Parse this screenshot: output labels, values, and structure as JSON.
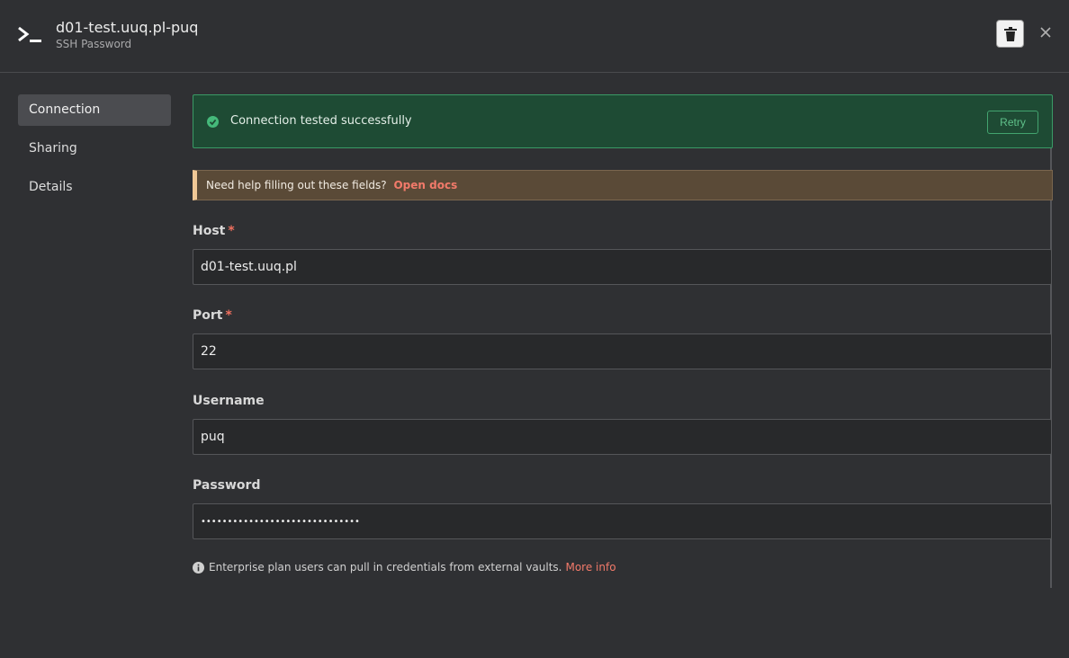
{
  "header": {
    "title": "d01-test.uuq.pl-puq",
    "subtitle": "SSH Password",
    "app_icon": "terminal-icon",
    "delete_icon": "trash-icon",
    "close_icon": "close-icon"
  },
  "sidebar": {
    "items": [
      {
        "label": "Connection",
        "active": true
      },
      {
        "label": "Sharing",
        "active": false
      },
      {
        "label": "Details",
        "active": false
      }
    ]
  },
  "status": {
    "message": "Connection tested successfully",
    "retry_label": "Retry",
    "icon": "check-circle-icon",
    "color": "#3a9a66"
  },
  "help": {
    "text": "Need help filling out these fields?",
    "link": "Open docs"
  },
  "form": {
    "host": {
      "label": "Host",
      "required_mark": "*",
      "value": "d01-test.uuq.pl"
    },
    "port": {
      "label": "Port",
      "required_mark": "*",
      "value": "22"
    },
    "username": {
      "label": "Username",
      "value": "puq"
    },
    "password": {
      "label": "Password",
      "value": "••••••••••••••••••••••••••••••"
    }
  },
  "footer_info": {
    "text": "Enterprise plan users can pull in credentials from external vaults.",
    "link": "More info",
    "icon": "info-circle-icon"
  }
}
